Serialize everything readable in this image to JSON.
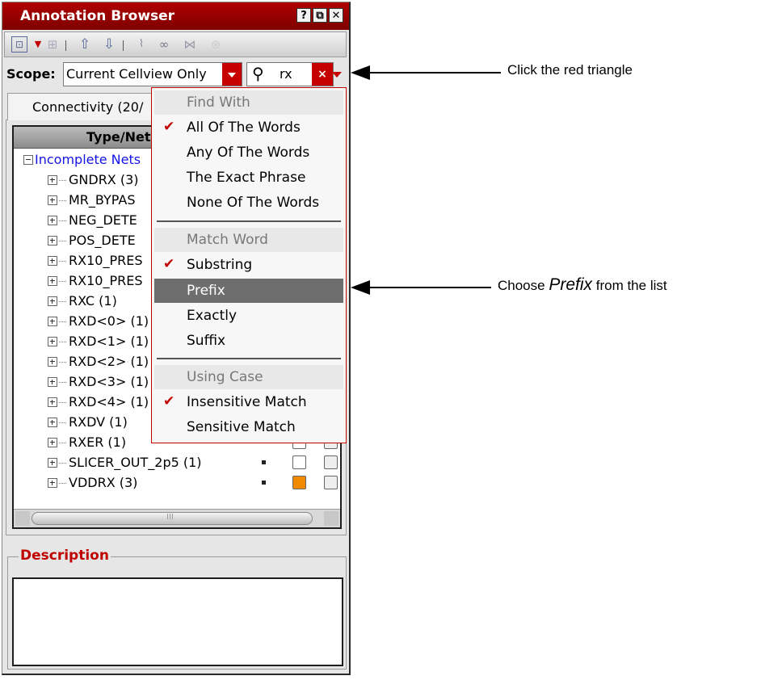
{
  "window": {
    "title": "Annotation Browser",
    "title_buttons": [
      "?",
      "⧉",
      "✕"
    ]
  },
  "toolbar": {
    "icons": [
      "select-icon",
      "dropdown-arrow-icon",
      "fit-icon",
      "up-arrow-icon",
      "down-arrow-icon",
      "path-icon",
      "probe-icon",
      "probe-all-icon",
      "close-circle-icon"
    ]
  },
  "scope": {
    "label": "Scope:",
    "value": "Current Cellview Only"
  },
  "search": {
    "value": "rx",
    "clear_label": "×"
  },
  "tab": {
    "label": "Connectivity (20/"
  },
  "tree": {
    "header": "Type/Net",
    "root": "Incomplete Nets",
    "items": [
      {
        "label": "GNDRX (3)"
      },
      {
        "label": "MR_BYPAS"
      },
      {
        "label": "NEG_DETE"
      },
      {
        "label": "POS_DETE"
      },
      {
        "label": "RX10_PRES"
      },
      {
        "label": "RX10_PRES"
      },
      {
        "label": "RXC (1)"
      },
      {
        "label": "RXD<0> (1)"
      },
      {
        "label": "RXD<1> (1)"
      },
      {
        "label": "RXD<2> (1)"
      },
      {
        "label": "RXD<3> (1)"
      },
      {
        "label": "RXD<4> (1)"
      },
      {
        "label": "RXDV (1)"
      },
      {
        "label": "RXER (1)"
      },
      {
        "label": "SLICER_OUT_2p5 (1)"
      },
      {
        "label": "VDDRX (3)"
      }
    ],
    "scrollbar_grip": "III"
  },
  "description": {
    "label": "Description",
    "text": ""
  },
  "menu": {
    "sections": [
      {
        "title": "Find With",
        "items": [
          {
            "label": "All Of The Words",
            "checked": true
          },
          {
            "label": "Any Of The Words",
            "checked": false
          },
          {
            "label": "The Exact Phrase",
            "checked": false
          },
          {
            "label": "None Of The Words",
            "checked": false
          }
        ]
      },
      {
        "title": "Match Word",
        "items": [
          {
            "label": "Substring",
            "checked": true
          },
          {
            "label": "Prefix",
            "checked": false,
            "highlighted": true
          },
          {
            "label": "Exactly",
            "checked": false
          },
          {
            "label": "Suffix",
            "checked": false
          }
        ]
      },
      {
        "title": "Using Case",
        "items": [
          {
            "label": "Insensitive Match",
            "checked": true
          },
          {
            "label": "Sensitive Match",
            "checked": false
          }
        ]
      }
    ]
  },
  "callouts": {
    "first": "Click the red triangle",
    "second_prefix": "Choose ",
    "second_emph": "Prefix",
    "second_suffix": " from the list"
  },
  "colors": {
    "title_bar": "#a00000",
    "accent_red": "#c60000",
    "menu_highlight": "#6e6e6e",
    "link_blue": "#1414e6",
    "status_orange": "#f28a00"
  }
}
